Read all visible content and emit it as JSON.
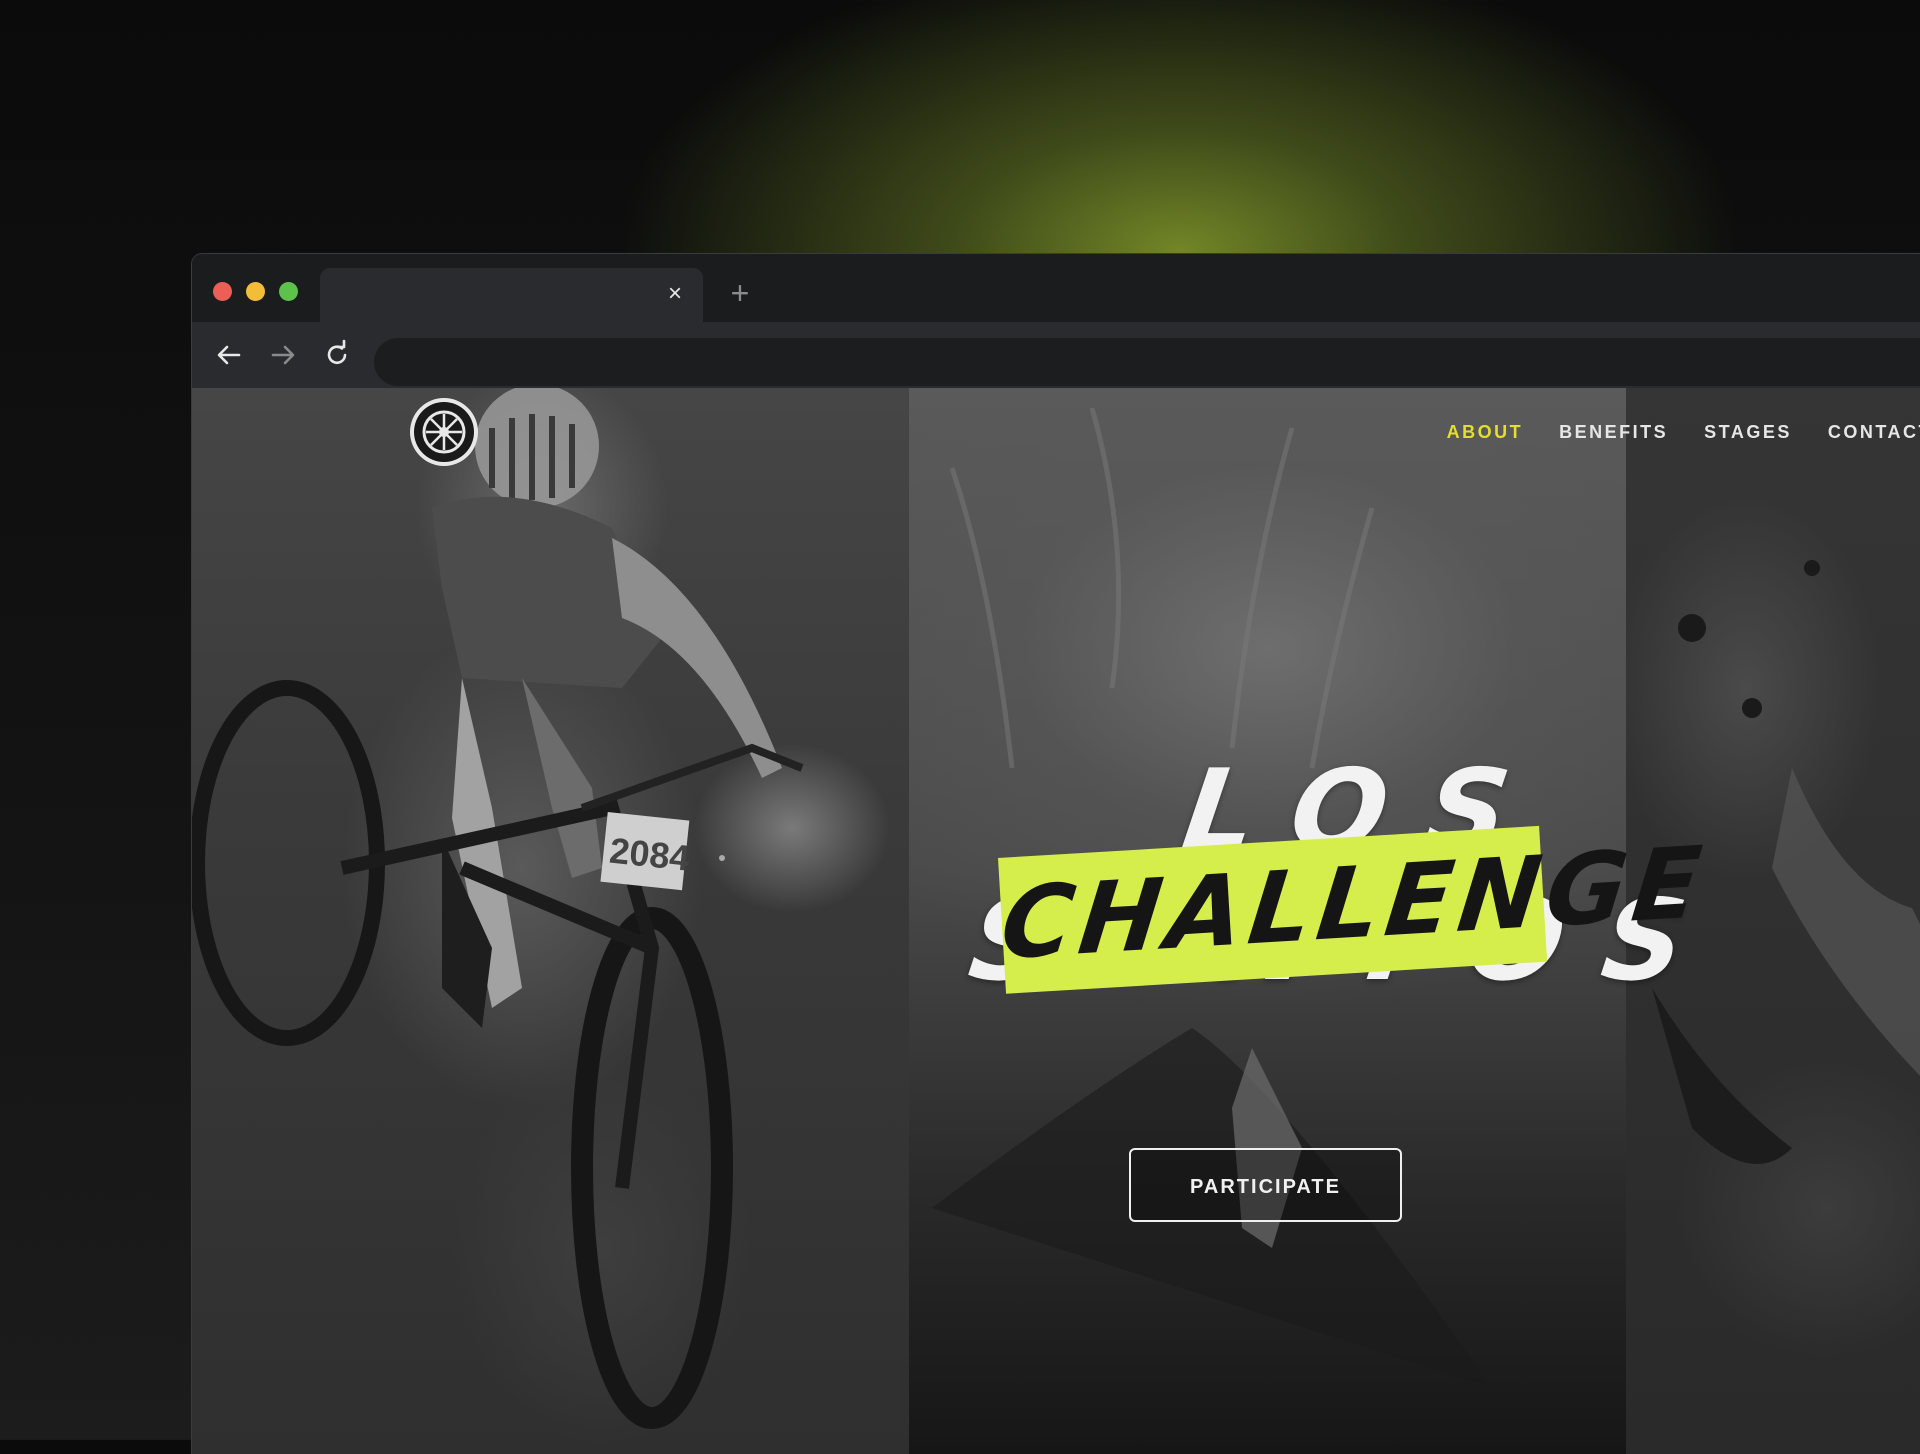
{
  "browser": {
    "tab_title": "",
    "close_icon": "×",
    "new_tab_icon": "+",
    "address_url": ""
  },
  "site": {
    "logo_text": "LOS SANTOS CHALLENGE",
    "nav": [
      {
        "label": "ABOUT",
        "active": true
      },
      {
        "label": "BENEFITS",
        "active": false
      },
      {
        "label": "STAGES",
        "active": false
      },
      {
        "label": "CONTACT",
        "active": false
      }
    ],
    "hero": {
      "title": "LOS SANTOS",
      "subtitle": "CHALLENGE",
      "cta_label": "PARTICIPATE",
      "race_number": "2084"
    }
  },
  "colors": {
    "accent": "#d5ee4c",
    "nav_active": "#e3df2e",
    "background_glow": "#6f8a2a"
  }
}
